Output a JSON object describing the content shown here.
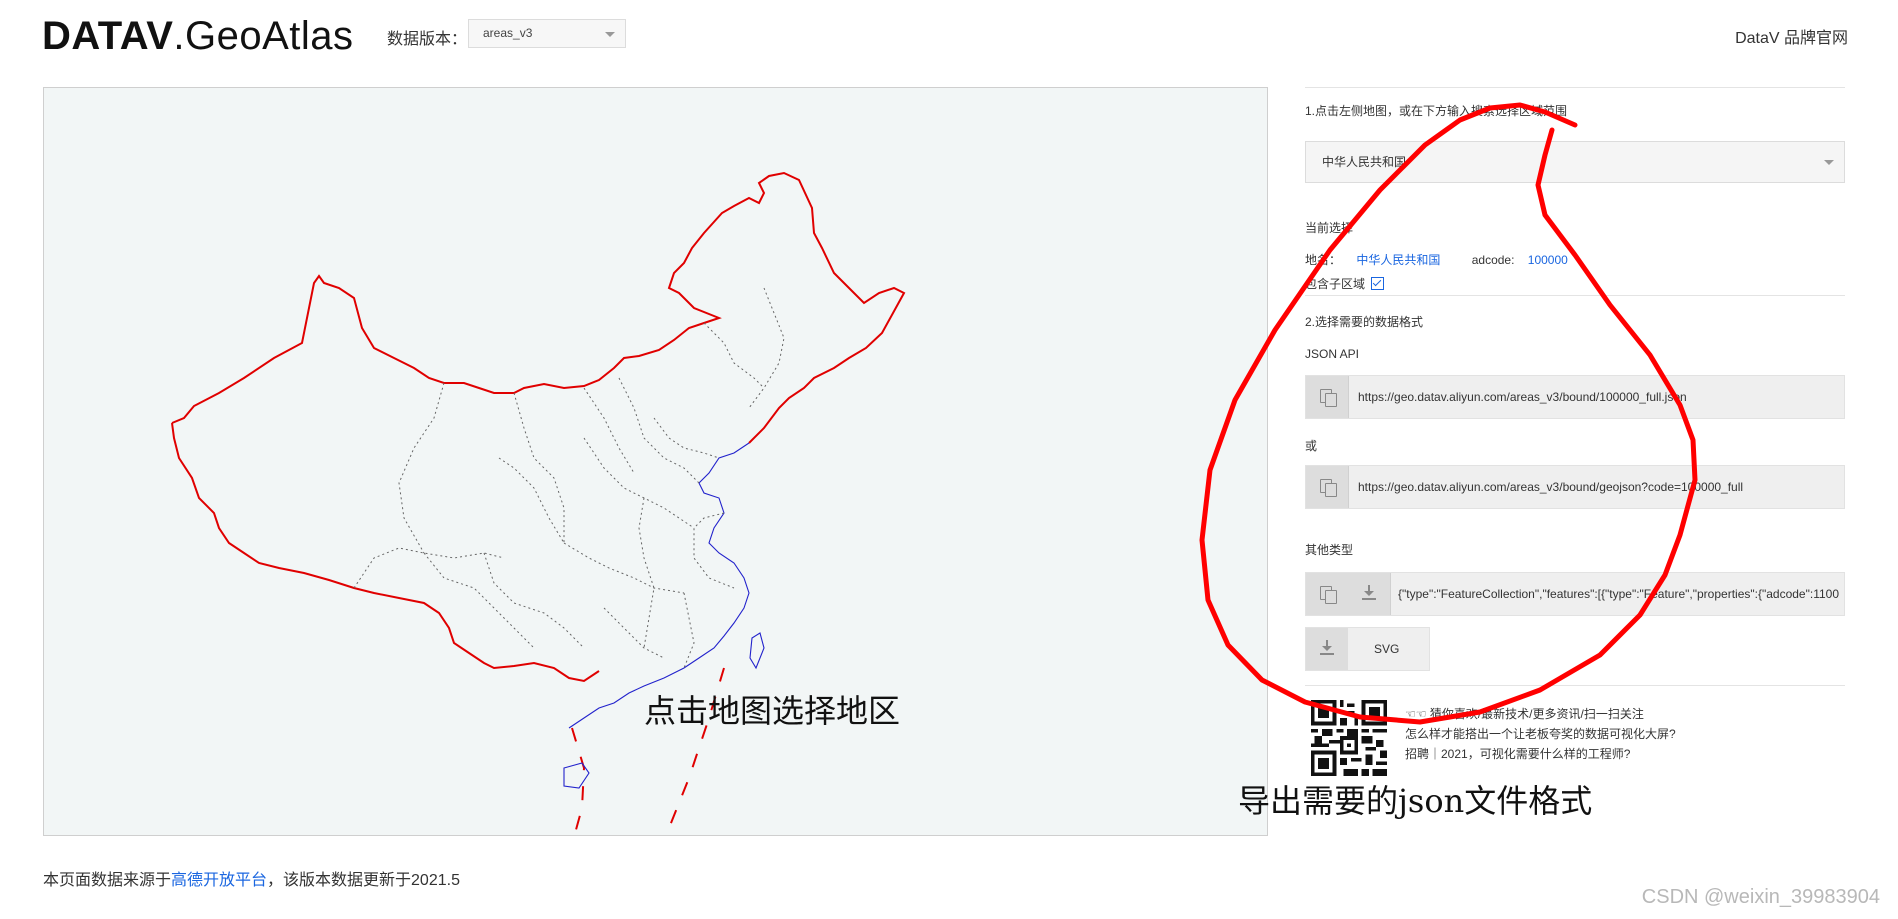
{
  "header": {
    "logo_bold": "DATAV",
    "logo_thin": ".GeoAtlas",
    "version_label": "数据版本：",
    "version_value": "areas_v3",
    "brand_link": "DataV 品牌官网"
  },
  "map": {
    "hint": "点击地图选择地区",
    "border_color": "#e00000",
    "coast_color": "#2222cc"
  },
  "panel": {
    "step1_label": "1.点击左侧地图，或在下方输入搜索选择区域范围",
    "region_value": "中华人民共和国",
    "current_label": "当前选择",
    "region_key": "地名：",
    "region_name": "中华人民共和国",
    "adcode_key": "adcode:",
    "adcode_value": "100000",
    "include_sub_label": "包含子区域",
    "step2_label": "2.选择需要的数据格式",
    "json_api_label": "JSON API",
    "api_url_1": "https://geo.datav.aliyun.com/areas_v3/bound/100000_full.json",
    "or_label": "或",
    "api_url_2": "https://geo.datav.aliyun.com/areas_v3/bound/geojson?code=100000_full",
    "other_types_label": "其他类型",
    "geojson_preview": "{\"type\":\"FeatureCollection\",\"features\":[{\"type\":\"Feature\",\"properties\":{\"adcode\":1100",
    "svg_label": "SVG",
    "promo_line_1": "☜☜ 猜你喜欢/最新技术/更多资讯/扫一扫关注",
    "promo_line_2": "怎么样才能搭出一个让老板夸奖的数据可视化大屏?",
    "promo_line_3": "招聘｜2021，可视化需要什么样的工程师?"
  },
  "annotation": {
    "export_hint": "导出需要的json文件格式",
    "circle_color": "#ff0000"
  },
  "footer": {
    "prefix": "本页面数据来源于",
    "source_link": "高德开放平台",
    "suffix": "，该版本数据更新于2021.5"
  },
  "watermark": "CSDN @weixin_39983904"
}
